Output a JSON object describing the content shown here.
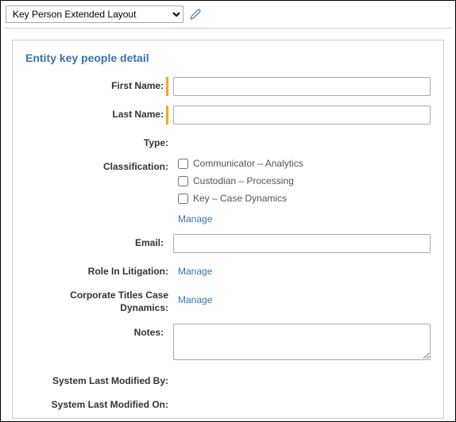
{
  "toolbar": {
    "layout_selected": "Key Person Extended Layout",
    "edit_icon": "pencil-icon"
  },
  "panel": {
    "title": "Entity key people detail",
    "fields": {
      "first_name_label": "First Name:",
      "first_name_value": "",
      "last_name_label": "Last Name:",
      "last_name_value": "",
      "type_label": "Type:",
      "classification_label": "Classification:",
      "classification_options": [
        {
          "label": "Communicator – Analytics"
        },
        {
          "label": "Custodian – Processing"
        },
        {
          "label": "Key – Case Dynamics"
        }
      ],
      "classification_manage": "Manage",
      "email_label": "Email:",
      "email_value": "",
      "role_label": "Role In Litigation:",
      "role_manage": "Manage",
      "corp_titles_label": "Corporate Titles Case Dynamics:",
      "corp_titles_manage": "Manage",
      "notes_label": "Notes:",
      "notes_value": "",
      "sys_mod_by_label": "System Last Modified By:",
      "sys_mod_on_label": "System Last Modified On:"
    }
  }
}
